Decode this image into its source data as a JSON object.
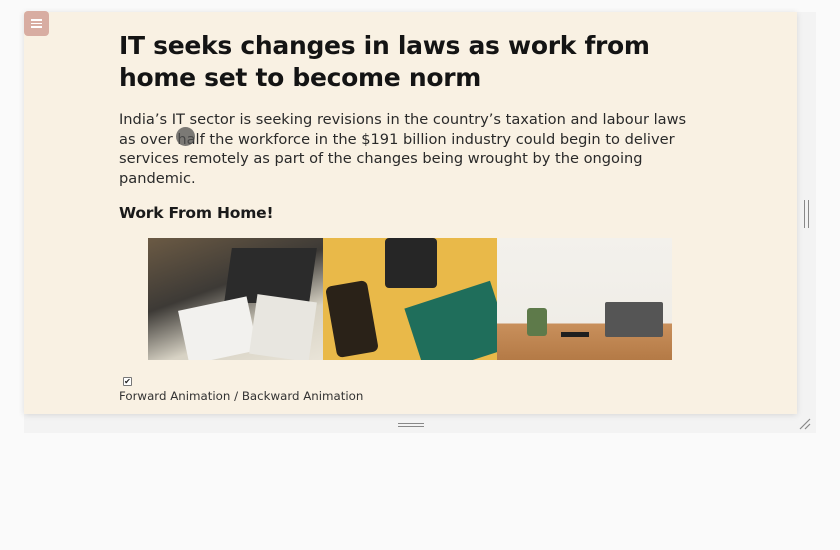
{
  "article": {
    "title": "IT seeks changes in laws as work from home set to become norm",
    "lead": "India’s IT sector is seeking revisions in the country’s taxation and labour laws as over half the workforce in the $191 billion industry could begin to deliver services remotely as part of the changes being wrought by the ongoing pandemic.",
    "subheading": "Work From Home!"
  },
  "controls": {
    "menu_icon": "hamburger-icon",
    "checkbox_checked": true,
    "checkbox_mark": "✔",
    "animation_forward": "Forward Animation",
    "animation_separator": " / ",
    "animation_backward": "Backward Animation"
  },
  "colors": {
    "card_bg": "#f9f1e3",
    "menu_button": "#d8ada2"
  }
}
